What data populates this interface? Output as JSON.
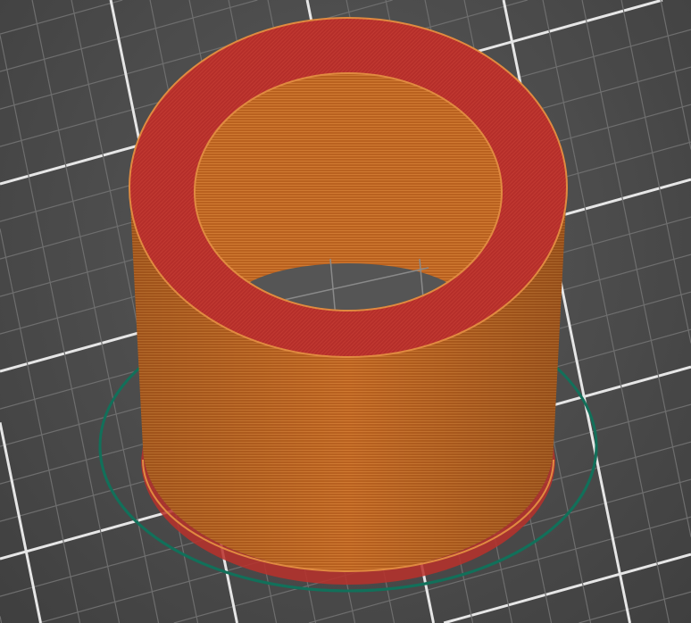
{
  "viewport": {
    "colors": {
      "bed": "#4b4b4b",
      "grid_minor": "#6e6e6e",
      "grid_major": "#e6e6e6",
      "perimeter": "#c0601c",
      "top_solid": "#b8302a",
      "skirt": "#12705a"
    }
  }
}
